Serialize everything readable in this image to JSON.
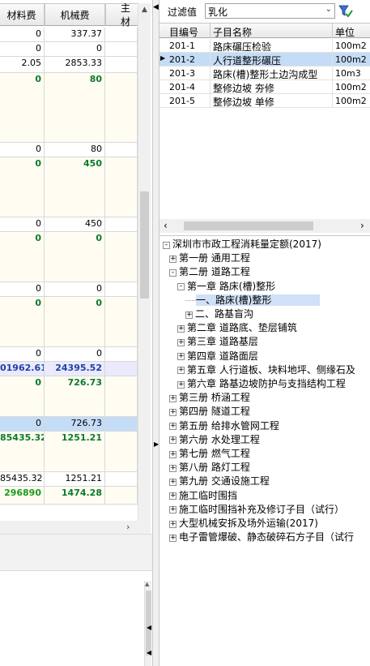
{
  "left_table": {
    "headers": [
      "材料费",
      "机械费",
      "主材"
    ],
    "rows": [
      {
        "c1": "0",
        "c2": "337.37",
        "style": "plain",
        "h": 18
      },
      {
        "c1": "0",
        "c2": "0",
        "style": "plain",
        "h": 18
      },
      {
        "c1": "2.05",
        "c2": "2853.33",
        "style": "plain",
        "h": 20
      },
      {
        "c1": "0",
        "c2": "80",
        "style": "green",
        "h": 86
      },
      {
        "c1": "0",
        "c2": "80",
        "style": "plain",
        "h": 18
      },
      {
        "c1": "0",
        "c2": "450",
        "style": "green",
        "h": 74
      },
      {
        "c1": "0",
        "c2": "450",
        "style": "plain",
        "h": 18
      },
      {
        "c1": "0",
        "c2": "0",
        "style": "green",
        "h": 62
      },
      {
        "c1": "0",
        "c2": "0",
        "style": "plain",
        "h": 18
      },
      {
        "c1": "0",
        "c2": "0",
        "style": "green",
        "h": 62
      },
      {
        "c1": "0",
        "c2": "0",
        "style": "plain",
        "h": 18
      },
      {
        "c1": "01962.61",
        "c2": "24395.52",
        "style": "blue",
        "h": 18
      },
      {
        "c1": "0",
        "c2": "726.73",
        "style": "green",
        "h": 50
      },
      {
        "c1": "0",
        "c2": "726.73",
        "style": "selected",
        "h": 18
      },
      {
        "c1": "85435.32",
        "c2": "1251.21",
        "style": "green",
        "h": 50
      },
      {
        "c1": "85435.32",
        "c2": "1251.21",
        "style": "plain",
        "h": 18
      },
      {
        "c1": "296890",
        "c2": "1474.28",
        "style": "green-bright",
        "h": 22
      }
    ]
  },
  "filter": {
    "label": "过滤值",
    "value": "乳化"
  },
  "sub_table": {
    "headers": [
      "目编号",
      "子目名称",
      "单位"
    ],
    "rows": [
      {
        "code": "201-1",
        "name": "路床碾压检验",
        "unit": "100m2",
        "selected": false
      },
      {
        "code": "201-2",
        "name": "人行道整形碾压",
        "unit": "100m2",
        "selected": true
      },
      {
        "code": "201-3",
        "name": "路床(槽)整形土边沟成型",
        "unit": "10m3",
        "selected": false
      },
      {
        "code": "201-4",
        "name": "整修边坡 夯修",
        "unit": "100m2",
        "selected": false
      },
      {
        "code": "201-5",
        "name": "整修边坡 单修",
        "unit": "100m2",
        "selected": false
      }
    ]
  },
  "tree": {
    "root": "深圳市市政工程消耗量定额(2017)",
    "nodes": [
      {
        "level": 1,
        "sign": "+",
        "label": "第一册 通用工程"
      },
      {
        "level": 1,
        "sign": "-",
        "label": "第二册 道路工程"
      },
      {
        "level": 2,
        "sign": "-",
        "label": "第一章 路床(槽)整形"
      },
      {
        "level": 3,
        "sign": "",
        "label": "一、路床(槽)整形",
        "selected": true
      },
      {
        "level": 3,
        "sign": "+",
        "label": "二、路基盲沟"
      },
      {
        "level": 2,
        "sign": "+",
        "label": "第二章 道路底、垫层铺筑"
      },
      {
        "level": 2,
        "sign": "+",
        "label": "第三章 道路基层"
      },
      {
        "level": 2,
        "sign": "+",
        "label": "第四章 道路面层"
      },
      {
        "level": 2,
        "sign": "+",
        "label": "第五章 人行道板、块料地坪、侧缘石及"
      },
      {
        "level": 2,
        "sign": "+",
        "label": "第六章 路基边坡防护与支挡结构工程"
      },
      {
        "level": 1,
        "sign": "+",
        "label": "第三册 桥涵工程"
      },
      {
        "level": 1,
        "sign": "+",
        "label": "第四册 隧道工程"
      },
      {
        "level": 1,
        "sign": "+",
        "label": "第五册 给排水管网工程"
      },
      {
        "level": 1,
        "sign": "+",
        "label": "第六册 水处理工程"
      },
      {
        "level": 1,
        "sign": "+",
        "label": "第七册 燃气工程"
      },
      {
        "level": 1,
        "sign": "+",
        "label": "第八册 路灯工程"
      },
      {
        "level": 1,
        "sign": "+",
        "label": "第九册 交通设施工程"
      },
      {
        "level": 1,
        "sign": "+",
        "label": "施工临时围挡"
      },
      {
        "level": 1,
        "sign": "+",
        "label": "施工临时围挡补充及修订子目（试行）"
      },
      {
        "level": 1,
        "sign": "+",
        "label": "大型机械安拆及场外运输(2017)"
      },
      {
        "level": 1,
        "sign": "+",
        "label": "电子雷管爆破、静态破碎石方子目（试行"
      }
    ]
  },
  "colors": {
    "accent_select": "#c5dcf6",
    "tree_select": "#cfe0f7",
    "green_text": "#0a7a2a",
    "blue_text": "#1f3fa8"
  },
  "icons": {
    "filter_button": "funnel-check-icon",
    "dropdown": "chevron-down-icon",
    "row_indicator": "triangle-right-icon"
  }
}
